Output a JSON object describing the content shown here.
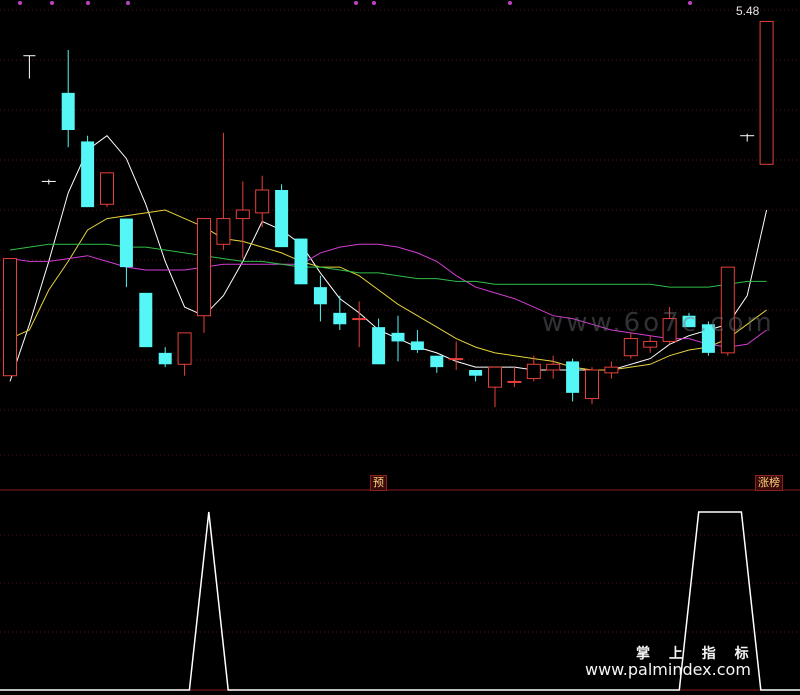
{
  "header": {
    "price_label": "5.48"
  },
  "markers": {
    "pre_label": "预",
    "limit_up_label": "涨榜"
  },
  "watermarks": {
    "mid": "www.6o7c.com",
    "brand_cn": "掌 上 指 标",
    "brand_url": "www.palmindex.com"
  },
  "colors": {
    "up": "#e8403a",
    "down": "#54f6f6",
    "ma5": "#ffffff",
    "ma10": "#e6d23c",
    "ma20": "#d33ed3",
    "ma60": "#2fbf4a",
    "signal": "#ffffff",
    "grid": "#5a1010"
  },
  "chart_data": [
    {
      "type": "candlestick",
      "y_axis": "price",
      "ylim": [
        4.1,
        5.5
      ],
      "candles": [
        {
          "o": 4.22,
          "h": 4.63,
          "l": 4.22,
          "c": 4.63
        },
        {
          "o": null,
          "h": 5.34,
          "l": 5.26,
          "c": null,
          "t": "dash"
        },
        {
          "o": null,
          "h": 4.9,
          "l": 4.9,
          "c": null,
          "t": "dash"
        },
        {
          "o": 5.21,
          "h": 5.36,
          "l": 5.02,
          "c": 5.08
        },
        {
          "o": 5.04,
          "h": 5.06,
          "l": 4.81,
          "c": 4.81
        },
        {
          "o": 4.82,
          "h": 4.93,
          "l": 4.81,
          "c": 4.93
        },
        {
          "o": 4.77,
          "h": 4.77,
          "l": 4.53,
          "c": 4.6
        },
        {
          "o": 4.51,
          "h": 4.51,
          "l": 4.32,
          "c": 4.32
        },
        {
          "o": 4.3,
          "h": 4.32,
          "l": 4.25,
          "c": 4.26
        },
        {
          "o": 4.26,
          "h": 4.37,
          "l": 4.22,
          "c": 4.37
        },
        {
          "o": 4.43,
          "h": 4.77,
          "l": 4.37,
          "c": 4.77
        },
        {
          "o": 4.68,
          "h": 5.07,
          "l": 4.66,
          "c": 4.77
        },
        {
          "o": 4.77,
          "h": 4.9,
          "l": 4.63,
          "c": 4.8
        },
        {
          "o": 4.79,
          "h": 4.92,
          "l": 4.74,
          "c": 4.87
        },
        {
          "o": 4.87,
          "h": 4.89,
          "l": 4.69,
          "c": 4.67
        },
        {
          "o": 4.7,
          "h": 4.7,
          "l": 4.54,
          "c": 4.54
        },
        {
          "o": 4.53,
          "h": 4.57,
          "l": 4.41,
          "c": 4.47
        },
        {
          "o": 4.44,
          "h": 4.5,
          "l": 4.38,
          "c": 4.4
        },
        {
          "o": 4.42,
          "h": 4.48,
          "l": 4.32,
          "c": 4.42
        },
        {
          "o": 4.39,
          "h": 4.42,
          "l": 4.26,
          "c": 4.26
        },
        {
          "o": 4.37,
          "h": 4.43,
          "l": 4.27,
          "c": 4.34
        },
        {
          "o": 4.34,
          "h": 4.38,
          "l": 4.3,
          "c": 4.31
        },
        {
          "o": 4.29,
          "h": 4.29,
          "l": 4.23,
          "c": 4.25
        },
        {
          "o": 4.28,
          "h": 4.34,
          "l": 4.24,
          "c": 4.28
        },
        {
          "o": 4.24,
          "h": 4.24,
          "l": 4.2,
          "c": 4.22
        },
        {
          "o": 4.18,
          "h": 4.25,
          "l": 4.11,
          "c": 4.25
        },
        {
          "o": 4.2,
          "h": 4.25,
          "l": 4.18,
          "c": 4.2
        },
        {
          "o": 4.21,
          "h": 4.29,
          "l": 4.2,
          "c": 4.26
        },
        {
          "o": 4.24,
          "h": 4.29,
          "l": 4.21,
          "c": 4.26
        },
        {
          "o": 4.27,
          "h": 4.28,
          "l": 4.13,
          "c": 4.16
        },
        {
          "o": 4.14,
          "h": 4.25,
          "l": 4.12,
          "c": 4.24
        },
        {
          "o": 4.23,
          "h": 4.27,
          "l": 4.21,
          "c": 4.25
        },
        {
          "o": 4.29,
          "h": 4.37,
          "l": 4.28,
          "c": 4.35
        },
        {
          "o": 4.32,
          "h": 4.36,
          "l": 4.3,
          "c": 4.34
        },
        {
          "o": 4.34,
          "h": 4.46,
          "l": 4.33,
          "c": 4.42
        },
        {
          "o": 4.43,
          "h": 4.44,
          "l": 4.39,
          "c": 4.39
        },
        {
          "o": 4.4,
          "h": 4.41,
          "l": 4.29,
          "c": 4.3
        },
        {
          "o": 4.3,
          "h": 4.6,
          "l": 4.29,
          "c": 4.6
        },
        {
          "o": null,
          "h": 5.06,
          "l": 5.05,
          "c": null,
          "t": "dash"
        },
        {
          "o": 4.96,
          "h": 5.46,
          "l": 4.96,
          "c": 5.46
        }
      ],
      "series": [
        {
          "name": "MA5",
          "values": [
            4.2,
            4.4,
            4.62,
            4.86,
            5.01,
            5.06,
            4.98,
            4.82,
            4.62,
            4.46,
            4.43,
            4.5,
            4.62,
            4.76,
            4.73,
            4.68,
            4.58,
            4.49,
            4.44,
            4.38,
            4.35,
            4.32,
            4.3,
            4.27,
            4.25,
            4.25,
            4.25,
            4.24,
            4.24,
            4.24,
            4.24,
            4.24,
            4.26,
            4.28,
            4.33,
            4.36,
            4.38,
            4.4,
            4.5,
            4.8
          ]
        },
        {
          "name": "MA10",
          "values": [
            4.35,
            4.38,
            4.52,
            4.62,
            4.73,
            4.77,
            4.78,
            4.79,
            4.8,
            4.77,
            4.74,
            4.7,
            4.69,
            4.67,
            4.65,
            4.62,
            4.6,
            4.6,
            4.57,
            4.52,
            4.47,
            4.43,
            4.39,
            4.35,
            4.32,
            4.3,
            4.29,
            4.28,
            4.27,
            4.25,
            4.24,
            4.24,
            4.25,
            4.26,
            4.29,
            4.31,
            4.32,
            4.35,
            4.4,
            4.45
          ]
        },
        {
          "name": "MA20",
          "values": [
            4.63,
            4.62,
            4.62,
            4.63,
            4.64,
            4.62,
            4.6,
            4.59,
            4.59,
            4.59,
            4.6,
            4.61,
            4.61,
            4.61,
            4.61,
            4.61,
            4.65,
            4.67,
            4.68,
            4.68,
            4.67,
            4.65,
            4.62,
            4.57,
            4.53,
            4.51,
            4.49,
            4.46,
            4.43,
            4.42,
            4.4,
            4.38,
            4.37,
            4.36,
            4.35,
            4.35,
            4.33,
            4.32,
            4.33,
            4.38
          ]
        },
        {
          "name": "MA60",
          "values": [
            4.66,
            4.67,
            4.68,
            4.68,
            4.68,
            4.68,
            4.67,
            4.67,
            4.66,
            4.65,
            4.64,
            4.63,
            4.62,
            4.62,
            4.61,
            4.6,
            4.6,
            4.59,
            4.58,
            4.58,
            4.57,
            4.56,
            4.56,
            4.55,
            4.55,
            4.54,
            4.54,
            4.54,
            4.54,
            4.54,
            4.54,
            4.54,
            4.54,
            4.54,
            4.53,
            4.53,
            4.53,
            4.54,
            4.55,
            4.55
          ]
        }
      ]
    },
    {
      "type": "line",
      "y_axis": "signal",
      "ylim": [
        0,
        1
      ],
      "x_breaks": [
        0,
        9.25,
        10.25,
        11.25,
        34.5,
        35.5,
        37.7,
        38.7,
        39
      ],
      "values": [
        0,
        0,
        1,
        0,
        0,
        1,
        1,
        0,
        0
      ]
    }
  ]
}
